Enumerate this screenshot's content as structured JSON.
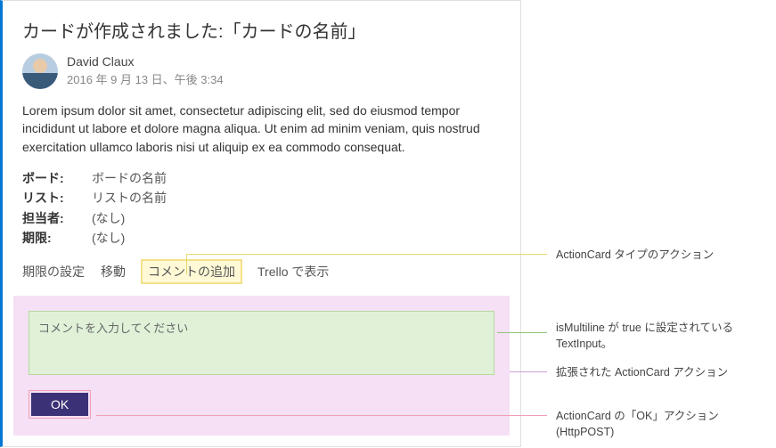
{
  "card": {
    "title": "カードが作成されました:「カードの名前」",
    "author": {
      "name": "David Claux",
      "date": "2016 年 9 月 13 日、午後 3:34"
    },
    "body": "Lorem ipsum dolor sit amet, consectetur adipiscing elit, sed do eiusmod tempor incididunt ut labore et dolore magna aliqua. Ut enim ad minim veniam, quis nostrud exercitation ullamco laboris nisi ut aliquip ex ea commodo consequat.",
    "facts": [
      {
        "label": "ボード:",
        "value": "ボードの名前"
      },
      {
        "label": "リスト:",
        "value": "リストの名前"
      },
      {
        "label": "担当者:",
        "value": "(なし)"
      },
      {
        "label": "期限:",
        "value": "(なし)"
      }
    ],
    "actions": {
      "set_due": "期限の設定",
      "move": "移動",
      "add_comment": "コメントの追加",
      "open_trello": "Trello で表示"
    },
    "comment_placeholder": "コメントを入力してください",
    "ok_label": "OK"
  },
  "annotations": {
    "actioncard_type": "ActionCard タイプのアクション",
    "multiline_textinput": "isMultiline が true に設定されている TextInput。",
    "expanded_actioncard": "拡張された ActionCard アクション",
    "ok_httppost": "ActionCard の「OK」アクション (HttpPOST)"
  }
}
